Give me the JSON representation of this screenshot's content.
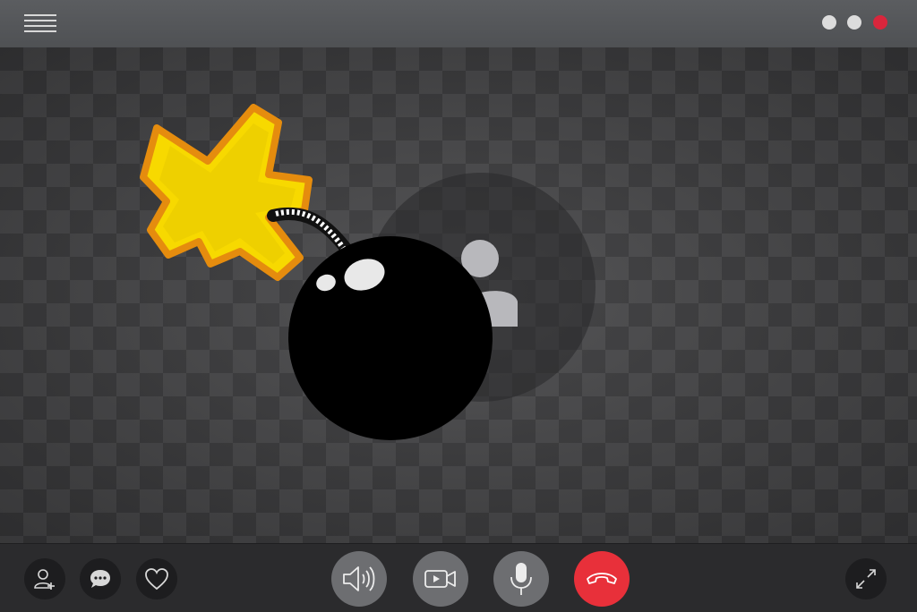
{
  "window": {
    "controls": [
      {
        "name": "minimize",
        "color": "#dcdcdc"
      },
      {
        "name": "maximize",
        "color": "#dcdcdc"
      },
      {
        "name": "close",
        "color": "#d9263c"
      }
    ]
  },
  "header": {
    "menu_icon": "hamburger-icon"
  },
  "stage": {
    "background": "checkerboard",
    "participant_icon": "user-icon",
    "overlay_icon": "bomb-icon"
  },
  "toolbar": {
    "left": [
      {
        "name": "add-contact",
        "icon": "add-user-icon"
      },
      {
        "name": "chat",
        "icon": "chat-bubble-icon"
      },
      {
        "name": "favorite",
        "icon": "heart-icon"
      }
    ],
    "center": [
      {
        "name": "speaker",
        "icon": "speaker-icon"
      },
      {
        "name": "video",
        "icon": "video-camera-icon"
      },
      {
        "name": "microphone",
        "icon": "microphone-icon"
      },
      {
        "name": "end-call",
        "icon": "hang-up-icon",
        "color": "#e8303a"
      }
    ],
    "right": [
      {
        "name": "fullscreen",
        "icon": "expand-icon"
      }
    ]
  }
}
